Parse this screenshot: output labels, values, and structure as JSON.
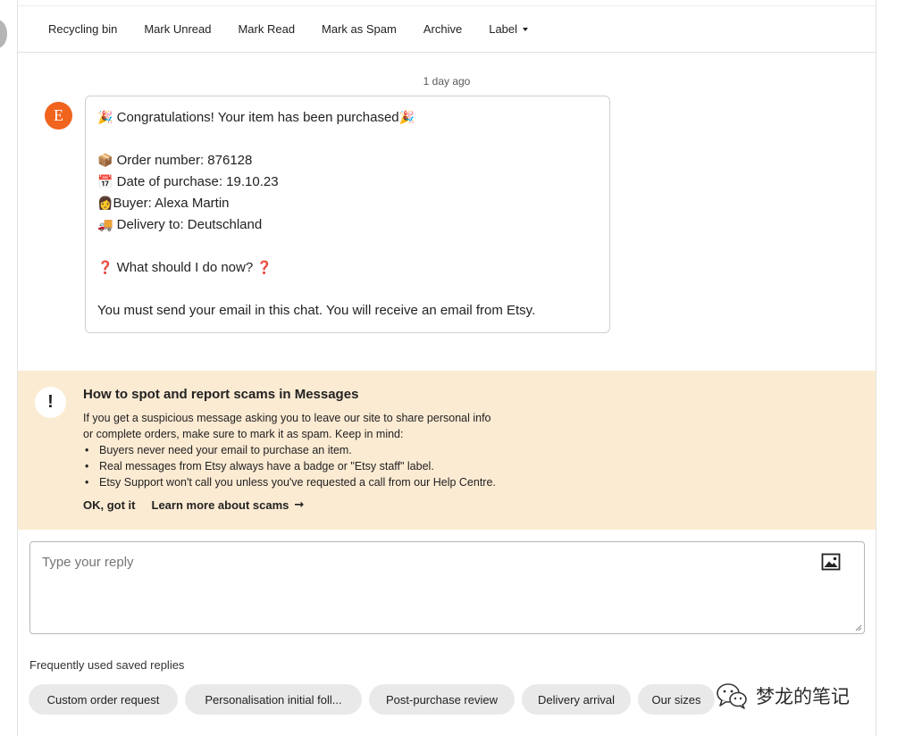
{
  "toolbar": {
    "items": [
      "Recycling bin",
      "Mark Unread",
      "Mark Read",
      "Mark as Spam",
      "Archive"
    ],
    "label_menu": "Label"
  },
  "conversation": {
    "timestamp": "1 day ago",
    "sender_initial": "E",
    "message": {
      "congrats": " Congratulations! Your item has been purchased",
      "order_number": " Order number: 876128",
      "date": " Date of purchase: 19.10.23",
      "buyer": "Buyer: Alexa Martin",
      "delivery": " Delivery to: Deutschland",
      "question": " What should I do now? ",
      "instruction": "You must send your email in this chat. You will receive an email from Etsy."
    }
  },
  "scam_banner": {
    "icon_symbol": "!",
    "title": "How to spot and report scams in Messages",
    "intro_line1": "If you get a suspicious message asking you to leave our site to share personal info",
    "intro_line2": "or complete orders, make sure to mark it as spam. Keep in mind:",
    "tips": [
      "Buyers never need your email to purchase an item.",
      "Real messages from Etsy always have a badge or \"Etsy staff\" label.",
      "Etsy Support won't call you unless you've requested a call from our Help Centre."
    ],
    "dismiss_label": "OK, got it",
    "learn_more_label": "Learn more about scams"
  },
  "reply": {
    "placeholder": "Type your reply"
  },
  "saved_replies": {
    "label": "Frequently used saved replies",
    "chips": [
      "Custom order request",
      "Personalisation initial foll...",
      "Post-purchase review",
      "Delivery arrival",
      "Our sizes"
    ]
  },
  "watermark": {
    "text": "梦龙的笔记"
  },
  "colors": {
    "avatar_orange": "#f1641e",
    "banner_bg": "#fcebd3",
    "chip_bg": "#e9e9e9"
  },
  "icons": {
    "congrats": "party-popper-icon",
    "order": "package-icon",
    "date": "calendar-icon",
    "buyer": "person-icon",
    "delivery": "delivery-truck-icon",
    "question": "red-question-mark-icon",
    "attach": "image-icon",
    "arrow": "arrow-right-icon",
    "watermark": "wechat-icon"
  }
}
